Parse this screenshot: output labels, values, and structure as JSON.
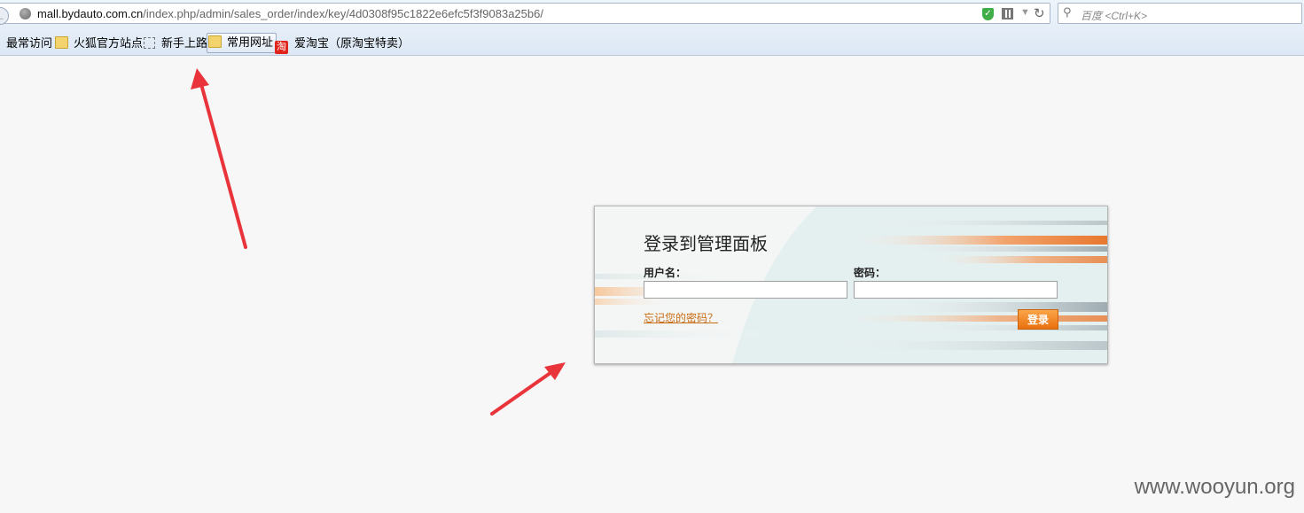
{
  "browser": {
    "url_host": "mall.bydauto.com.cn",
    "url_path": "/index.php/admin/sales_order/index/key/4d0308f95c1822e6efc5f3f9083a25b6/",
    "search_placeholder": "百度 <Ctrl+K>",
    "bookmarks": [
      {
        "label": "最常访问",
        "icon": "none"
      },
      {
        "label": "火狐官方站点",
        "icon": "folder-icon"
      },
      {
        "label": "新手上路",
        "icon": "dashed-box-icon"
      },
      {
        "label": "常用网址",
        "icon": "folder-icon"
      },
      {
        "label": "爱淘宝（原淘宝特卖）",
        "icon": "taobao-icon",
        "icon_text": "淘"
      }
    ]
  },
  "login": {
    "title": "登录到管理面板",
    "username_label": "用户名：",
    "password_label": "密码：",
    "forgot_link": "忘记您的密码？",
    "submit_label": "登录"
  },
  "watermark": "www.wooyun.org",
  "colors": {
    "accent_orange": "#f0821e",
    "link_orange": "#c86a10",
    "annotation_red": "#e8343a"
  }
}
